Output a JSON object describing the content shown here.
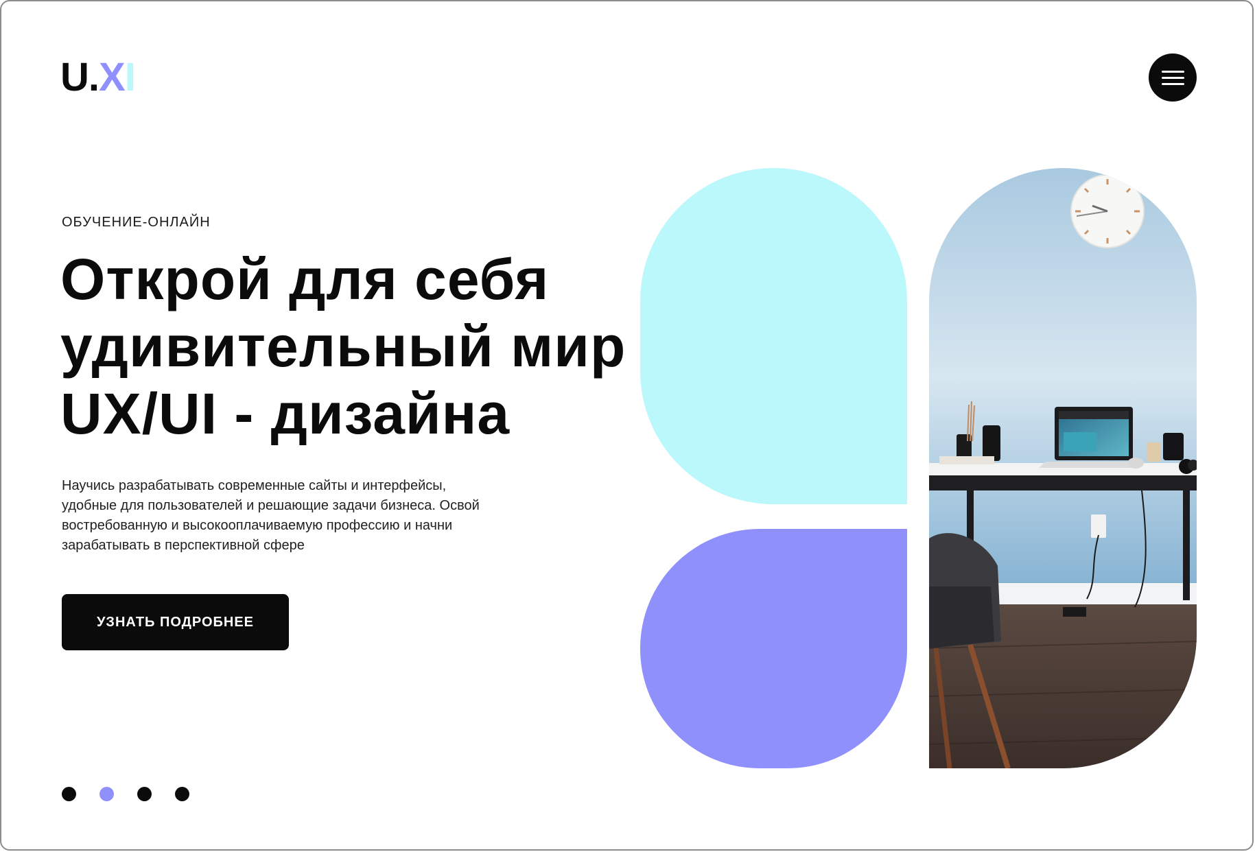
{
  "logo": {
    "part_u": "U.",
    "part_x": "X",
    "part_i": "I"
  },
  "eyebrow": "ОБУЧЕНИЕ-ОНЛАЙН",
  "headline": [
    "Открой для себя",
    "удивительный мир",
    "UX/UI - дизайна"
  ],
  "description": [
    "Научись разрабатывать современные сайты и интерфейсы,",
    "удобные для пользователей и решающие задачи бизнеса. Освой",
    "востребованную и высокооплачиваемую профессию и начни",
    "зарабатывать в перспективной сфере"
  ],
  "cta_label": "УЗНАТЬ ПОДРОБНЕЕ",
  "pagination": {
    "count": 4,
    "active_index": 1
  },
  "colors": {
    "dark": "#0b0b0b",
    "accent_violet": "#9090fd",
    "accent_cyan": "#bbf8fc",
    "wall_blue": "#8fbad8",
    "floor": "#4a3a33"
  },
  "icons": {
    "menu": "hamburger-icon"
  }
}
